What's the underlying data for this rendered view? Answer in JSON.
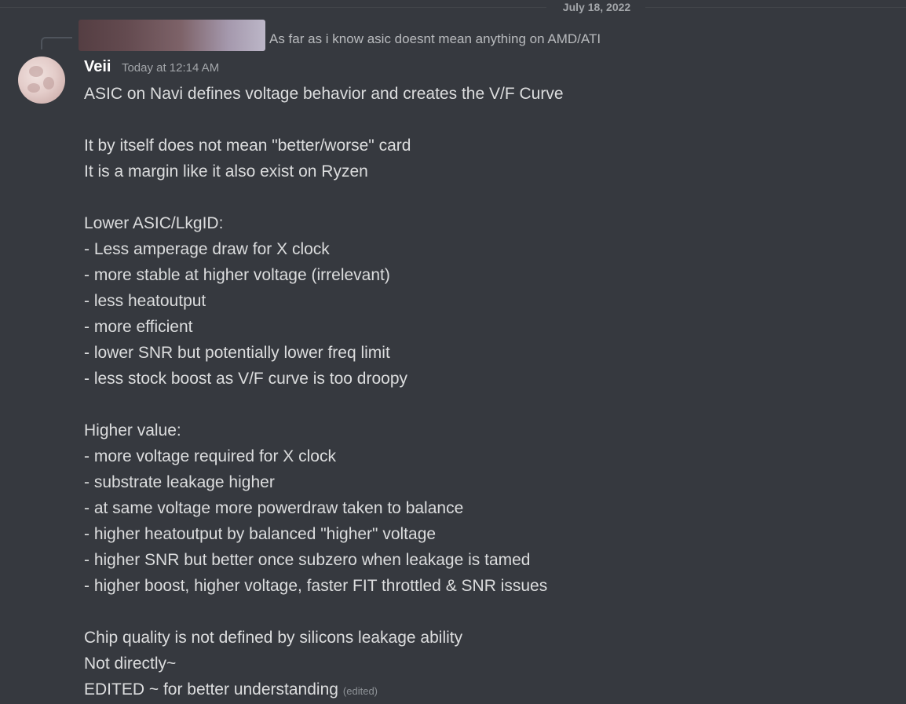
{
  "date_divider": "July 18, 2022",
  "reply": {
    "text": "As far as i know asic doesnt mean anything on AMD/ATI"
  },
  "message": {
    "author": "Veii",
    "timestamp": "Today at 12:14 AM",
    "lines": [
      "ASIC on Navi defines voltage behavior and creates the V/F Curve",
      "",
      "It by itself does not mean \"better/worse\" card",
      "It is a margin like it also exist on Ryzen",
      "",
      "Lower ASIC/LkgID:",
      "- Less amperage draw for X  clock",
      "- more stable at higher voltage (irrelevant)",
      "- less heatoutput",
      "- more efficient",
      "- lower SNR but potentially lower freq limit",
      "- less stock boost as V/F curve is too droopy",
      "",
      "Higher value:",
      "- more voltage required for X clock",
      "- substrate leakage higher",
      "- at same voltage more powerdraw taken to balance",
      "- higher heatoutput by balanced \"higher\" voltage",
      "- higher SNR but better once subzero when leakage is tamed",
      "- higher boost, higher voltage, faster FIT throttled & SNR issues",
      "",
      "Chip quality is not defined by silicons leakage ability",
      "Not directly~",
      "EDITED ~ for better understanding"
    ],
    "edited_label": "(edited)"
  }
}
